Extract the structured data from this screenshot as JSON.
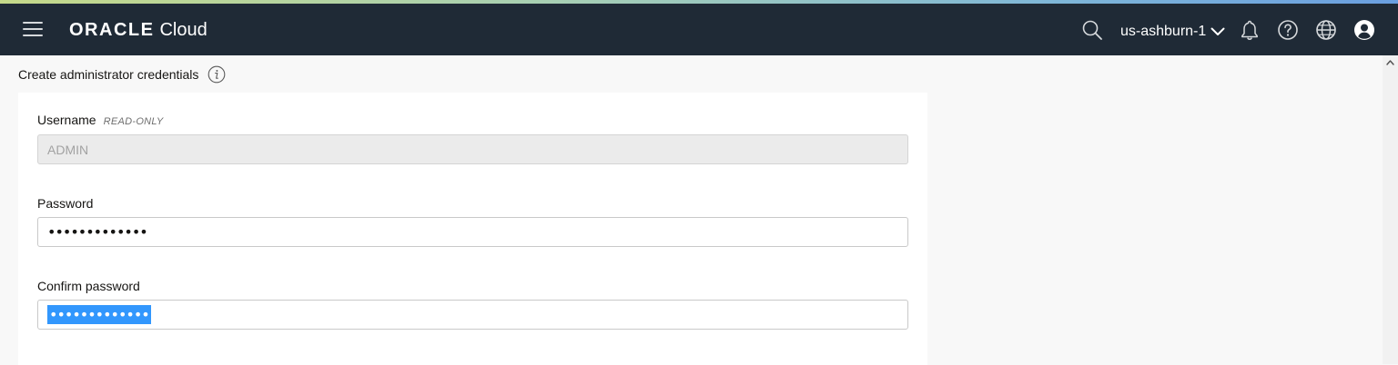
{
  "header": {
    "brand_oracle": "ORACLE",
    "brand_cloud": "Cloud",
    "region": "us-ashburn-1",
    "background": "#1f2a36",
    "icons": [
      "menu-icon",
      "search-icon",
      "chevron-down-icon",
      "bell-icon",
      "help-icon",
      "globe-icon",
      "user-icon"
    ]
  },
  "section": {
    "title": "Create administrator credentials"
  },
  "form": {
    "username_label": "Username",
    "username_readonly_tag": "READ-ONLY",
    "username_value": "ADMIN",
    "password_label": "Password",
    "password_value": "•••••••••••••",
    "confirm_label": "Confirm password",
    "confirm_value": "•••••••••••••"
  },
  "colors": {
    "selection": "#3297fd",
    "readonly_bg": "#ebebeb"
  }
}
